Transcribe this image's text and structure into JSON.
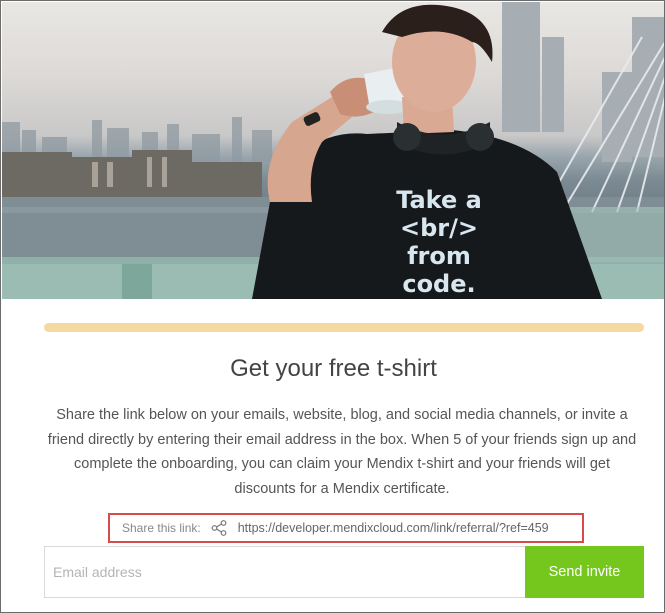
{
  "hero": {
    "shirt_line1": "Take a",
    "shirt_line2": "<br/>",
    "shirt_line3": "from code."
  },
  "progress": {
    "fraction": 1.0,
    "color": "#f6d9a0"
  },
  "title": "Get your free t-shirt",
  "description": "Share the link below on your emails, website, blog, and social media channels, or invite a friend directly by entering their email address in the box. When 5 of your friends sign up and complete the onboarding, you can claim your Mendix t-shirt and your friends will get discounts for a Mendix certificate.",
  "share": {
    "label": "Share this link:",
    "icon": "share-icon",
    "url": "https://developer.mendixcloud.com/link/referral/?ref=459",
    "highlight_color": "#d84b4b"
  },
  "invite": {
    "email_placeholder": "Email address",
    "email_value": "",
    "send_label": "Send invite",
    "button_color": "#76c71d"
  }
}
